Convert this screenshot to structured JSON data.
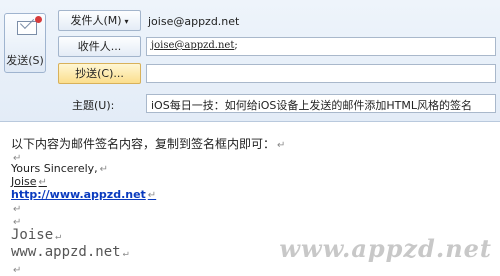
{
  "compose": {
    "send_label": "发送(S)",
    "from_button_label": "发件人(M)",
    "from_button_caret": "▾",
    "from_address": "joise@appzd.net",
    "to_button_label": "收件人...",
    "to_value": "joise@appzd.net",
    "to_separator": ";",
    "cc_button_label": "抄送(C)...",
    "cc_value": "",
    "subject_label": "主题(U):",
    "subject_value": "iOS每日一技：如何给iOS设备上发送的邮件添加HTML风格的签名"
  },
  "body": {
    "intro": "以下内容为邮件签名内容，复制到签名框内即可：",
    "paragraph_mark": "↵",
    "yours": "Yours Sincerely,",
    "name_small": "Joise",
    "link": "http://www.appzd.net",
    "name_large": "Joise",
    "site_large": "www.appzd.net"
  },
  "watermark": "www.appzd.net"
}
